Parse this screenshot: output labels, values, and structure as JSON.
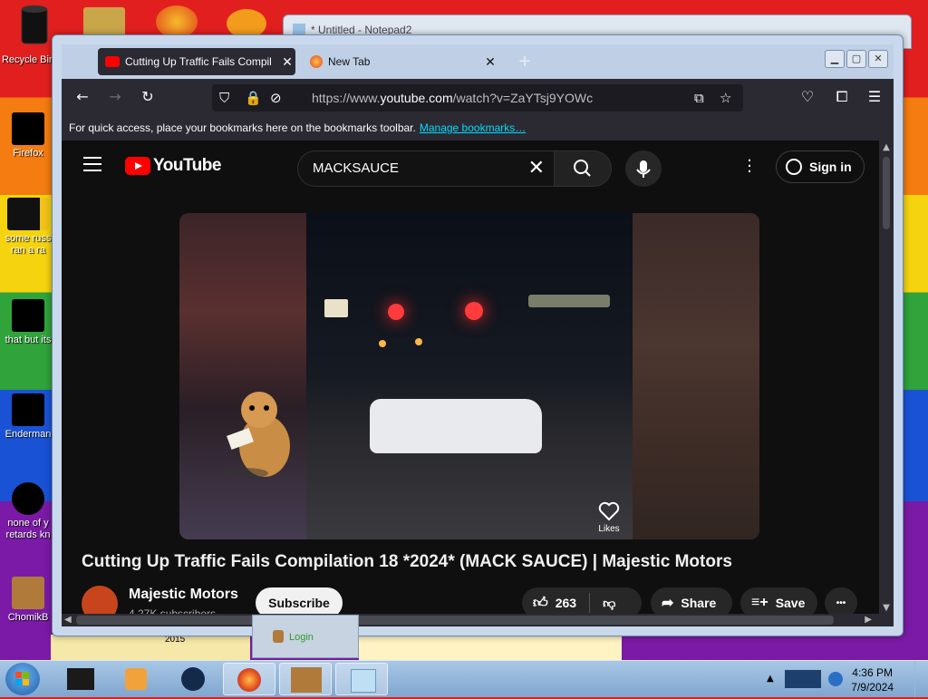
{
  "desktop": {
    "icons": [
      {
        "label": "Recycle Bin",
        "name": "recycle-bin-icon"
      },
      {
        "label": "Firefox",
        "name": "firefox-icon"
      },
      {
        "label": "some russ ran a ra",
        "name": "file-icon"
      },
      {
        "label": "that but its",
        "name": "folder-icon"
      },
      {
        "label": "Enderman",
        "name": "app-icon"
      },
      {
        "label": "none of y retards kn",
        "name": "chrome-icon"
      },
      {
        "label": "ChomikB",
        "name": "hamster-icon"
      }
    ],
    "bg_text": "2015"
  },
  "notepad": {
    "title": "* Untitled - Notepad2"
  },
  "browser": {
    "tabs": [
      {
        "label": "Cutting Up Traffic Fails Compil",
        "favicon": "youtube-icon",
        "active": true
      },
      {
        "label": "New Tab",
        "favicon": "firefox-icon",
        "active": false
      }
    ],
    "newtab_symbol": "+",
    "url_prefix": "https://www.",
    "url_domain": "youtube.com",
    "url_path": "/watch?v=ZaYTsj9YOWc",
    "bookmarks_text": "For quick access, place your bookmarks here on the bookmarks toolbar.",
    "bookmarks_link": "Manage bookmarks…"
  },
  "youtube": {
    "logo_text": "YouTube",
    "search_value": "MACKSAUCE",
    "sign_in": "Sign in",
    "video": {
      "likes_label": "Likes"
    },
    "title": "Cutting Up Traffic Fails Compilation 18 *2024* (MACK SAUCE) | Majestic Motors",
    "channel": "Majestic Motors",
    "subscribers": "4.27K subscribers",
    "subscribe": "Subscribe",
    "like_count": "263",
    "share": "Share",
    "save": "Save",
    "more": "•••"
  },
  "taskbar": {
    "tooltip_label": "Login",
    "clock_time": "4:36 PM",
    "clock_date": "7/9/2024"
  },
  "colors": {
    "youtube_red": "#ff0000",
    "firefox_dark": "#2b2a33",
    "link": "#00ddff"
  }
}
